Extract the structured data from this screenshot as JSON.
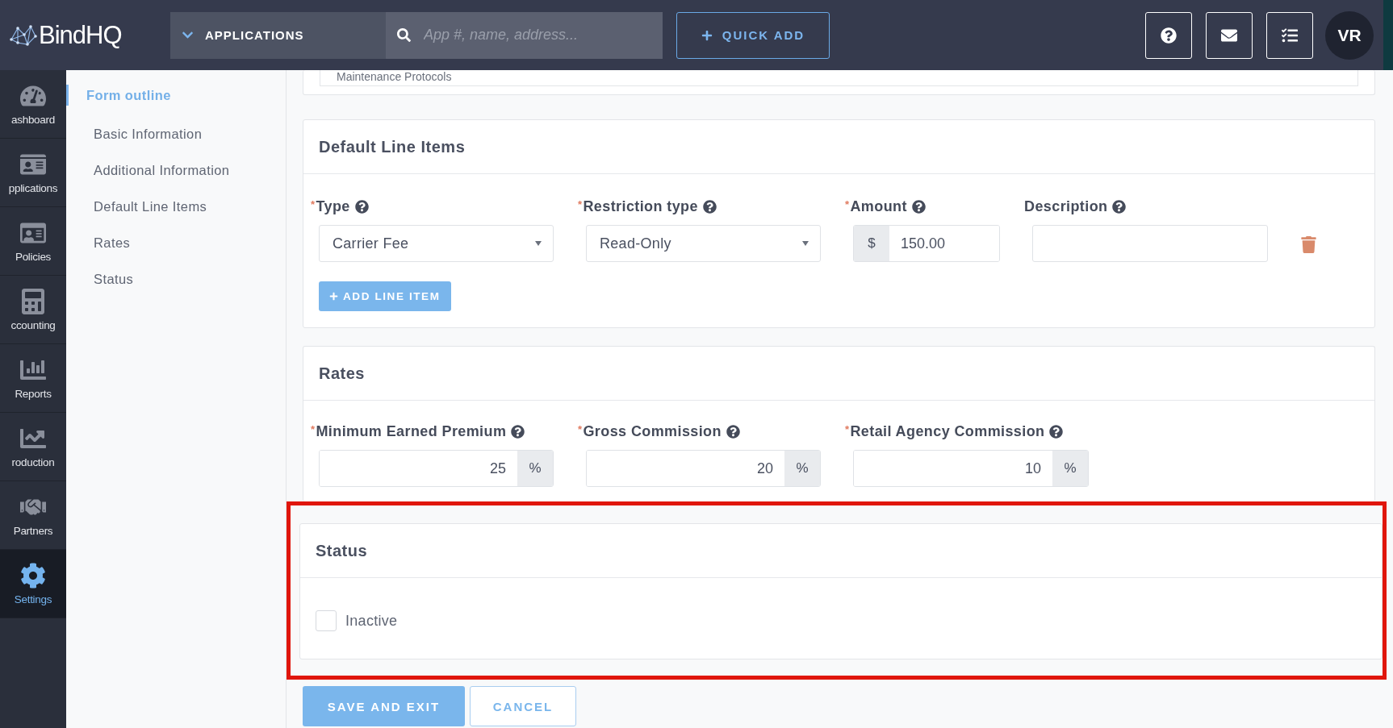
{
  "header": {
    "logo": "BindHQ",
    "menu_label": "APPLICATIONS",
    "search": {
      "placeholder": "App #, name, address..."
    },
    "quick_add": "QUICK ADD",
    "avatar": "VR"
  },
  "nav": [
    {
      "label": "ashboard",
      "selected": false
    },
    {
      "label": "pplications",
      "selected": false
    },
    {
      "label": "Policies",
      "selected": false
    },
    {
      "label": "ccounting",
      "selected": false
    },
    {
      "label": "Reports",
      "selected": false
    },
    {
      "label": "roduction",
      "selected": false
    },
    {
      "label": "Partners",
      "selected": false
    },
    {
      "label": "Settings",
      "selected": true
    }
  ],
  "outline": {
    "title": "Form outline",
    "items": [
      "Basic Information",
      "Additional Information",
      "Default Line Items",
      "Rates",
      "Status"
    ]
  },
  "previous_field": {
    "value": "Maintenance Protocols"
  },
  "line_items": {
    "title": "Default Line Items",
    "columns": [
      {
        "label": "Type",
        "required_mark": "*"
      },
      {
        "label": "Restriction type",
        "required_mark": "*"
      },
      {
        "label": "Amount",
        "required_mark": "*"
      },
      {
        "label": "Description"
      }
    ],
    "row": {
      "type": "Carrier Fee",
      "restriction": "Read-Only",
      "currency": "$",
      "amount": "150.00"
    },
    "add_button": "ADD LINE ITEM"
  },
  "rates": {
    "title": "Rates",
    "fields": [
      {
        "label": "Minimum Earned Premium",
        "required_mark": "*",
        "value": "25",
        "unit": "%"
      },
      {
        "label": "Gross Commission",
        "required_mark": "*",
        "value": "20",
        "unit": "%"
      },
      {
        "label": "Retail Agency Commission",
        "required_mark": "*",
        "value": "10",
        "unit": "%"
      }
    ]
  },
  "status": {
    "title": "Status",
    "highlighted": true,
    "options": [
      {
        "label": "Inactive",
        "checked": false
      }
    ]
  },
  "actions": [
    {
      "label": "SAVE AND EXIT",
      "kind": "primary"
    },
    {
      "label": "CANCEL",
      "kind": "secondary"
    }
  ]
}
